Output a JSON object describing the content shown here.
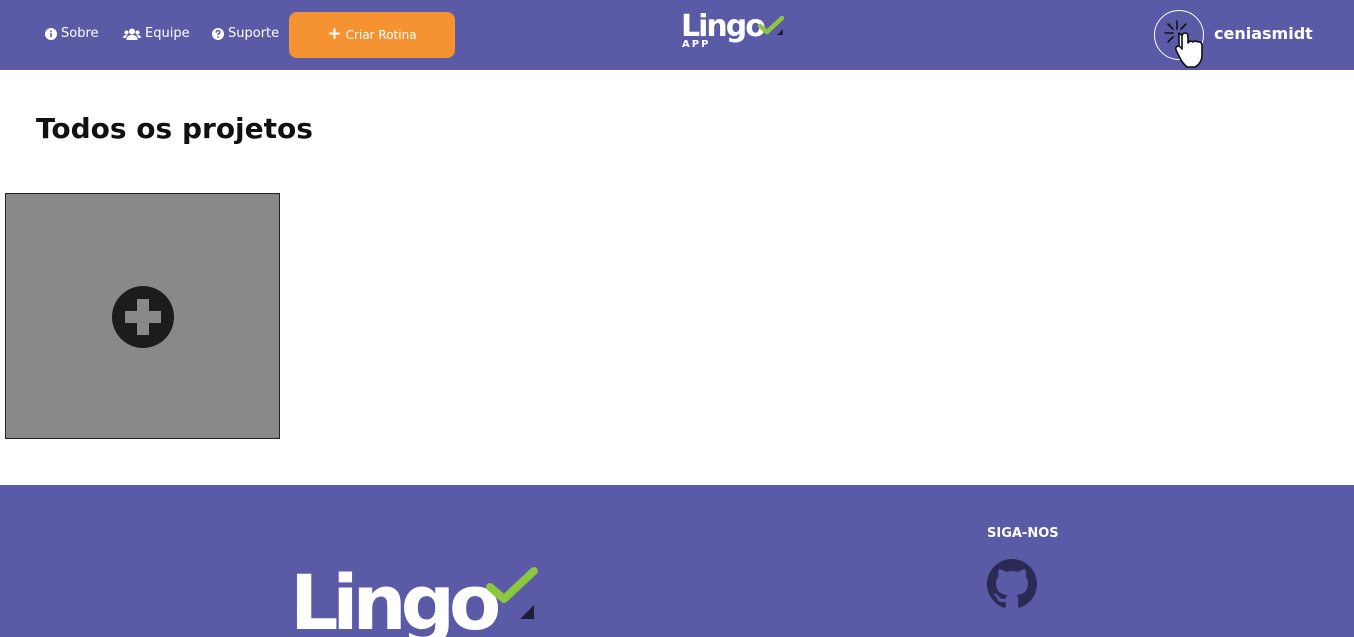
{
  "nav": {
    "about_label": "Sobre",
    "team_label": "Equipe",
    "support_label": "Suporte",
    "create_button_label": "Criar Rotina"
  },
  "brand": {
    "logo_text": "Lingo",
    "logo_subtext": "APP",
    "check_color": "#8dc63f"
  },
  "user": {
    "username": "ceniasmidt"
  },
  "main": {
    "page_title": "Todos os projetos"
  },
  "footer": {
    "follow_title": "SIGA-NOS",
    "logo_text": "Lingo"
  },
  "colors": {
    "primary": "#5a5aa7",
    "accent": "#f59332",
    "card": "#898989"
  },
  "icons": {
    "about": "info-circle-icon",
    "team": "users-icon",
    "support": "question-circle-icon",
    "create": "plus-icon",
    "avatar": "pointer-click-icon",
    "add_project": "plus-circle-icon",
    "social": "github-icon"
  }
}
